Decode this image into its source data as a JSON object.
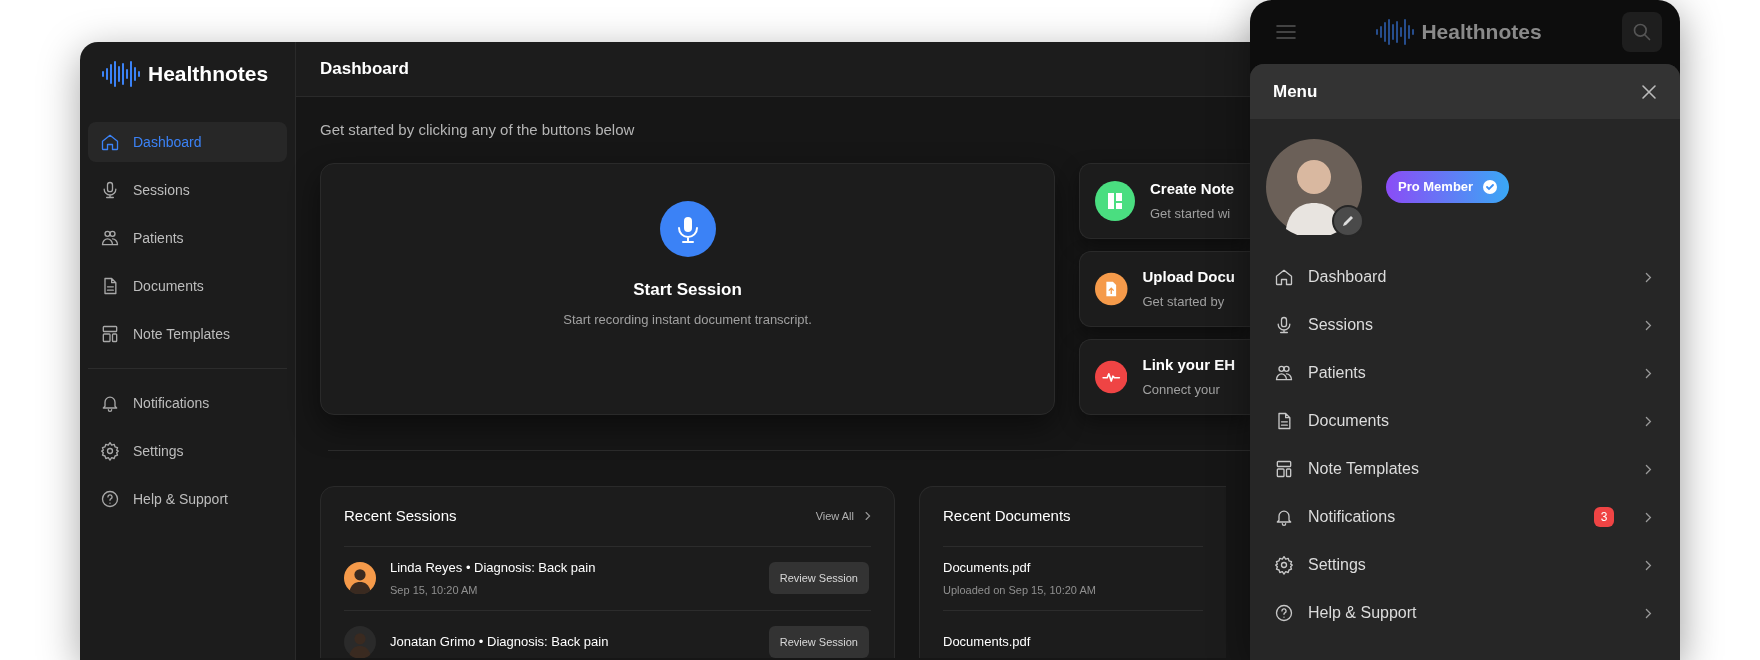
{
  "brand": "Healthnotes",
  "page_title": "Dashboard",
  "sidebar": {
    "main_items": [
      {
        "label": "Dashboard",
        "selected": true
      },
      {
        "label": "Sessions",
        "selected": false
      },
      {
        "label": "Patients",
        "selected": false
      },
      {
        "label": "Documents",
        "selected": false
      },
      {
        "label": "Note Templates",
        "selected": false
      }
    ],
    "secondary_items": [
      {
        "label": "Notifications",
        "selected": false
      },
      {
        "label": "Settings",
        "selected": false
      },
      {
        "label": "Help & Support",
        "selected": false
      }
    ]
  },
  "intro": "Get started by clicking any of the buttons below",
  "start_card": {
    "title": "Start Session",
    "description": "Start recording instant document transcript."
  },
  "actions": [
    {
      "title": "Create Note",
      "subtitle": "Get started wi",
      "color": "#4ade80"
    },
    {
      "title": "Upload Docu",
      "subtitle": "Get started by",
      "color": "#f59a4a"
    },
    {
      "title": "Link your EH",
      "subtitle": "Connect your",
      "color": "#ef4444"
    }
  ],
  "recent_sessions": {
    "title": "Recent Sessions",
    "link": "View All",
    "rows": [
      {
        "name": "Linda Reyes • Diagnosis: Back pain",
        "time": "Sep 15, 10:20 AM",
        "button": "Review Session"
      },
      {
        "name": "Jonatan Grimo • Diagnosis: Back pain",
        "button": "Review Session"
      }
    ]
  },
  "recent_documents": {
    "title": "Recent Documents",
    "rows": [
      {
        "name": "Documents.pdf",
        "subtitle": "Uploaded on Sep 15, 10:20 AM"
      },
      {
        "name": "Documents.pdf"
      }
    ]
  },
  "mobile": {
    "brand": "Healthnotes",
    "menu_title": "Menu",
    "badge": "Pro Member",
    "items": [
      {
        "label": "Dashboard"
      },
      {
        "label": "Sessions"
      },
      {
        "label": "Patients"
      },
      {
        "label": "Documents"
      },
      {
        "label": "Note Templates"
      },
      {
        "label": "Notifications",
        "count": "3"
      },
      {
        "label": "Settings"
      },
      {
        "label": "Help & Support"
      }
    ]
  }
}
